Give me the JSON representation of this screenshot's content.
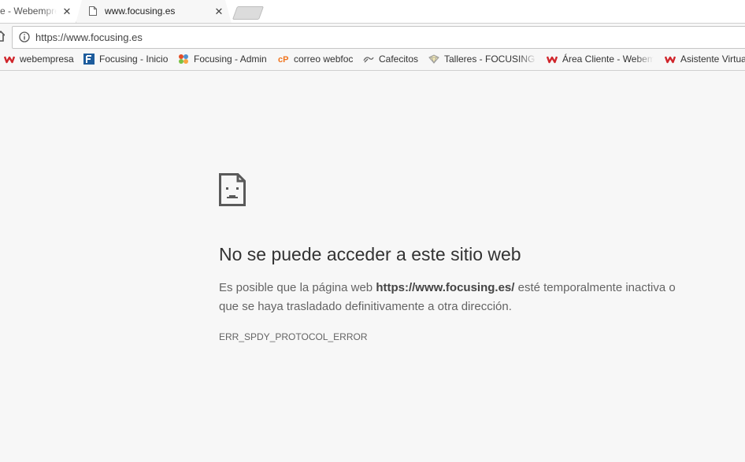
{
  "tabs": [
    {
      "title": "e - Webempresa",
      "close": "✕"
    },
    {
      "title": "www.focusing.es",
      "close": "✕"
    }
  ],
  "omnibox": {
    "url": "https://www.focusing.es"
  },
  "bookmarks": [
    {
      "label": "webempresa",
      "icon": "webempresa-icon"
    },
    {
      "label": "Focusing - Inicio",
      "icon": "focusing-icon"
    },
    {
      "label": "Focusing - Admin",
      "icon": "joomla-icon"
    },
    {
      "label": "correo webfoc",
      "icon": "cpanel-icon"
    },
    {
      "label": "Cafecitos",
      "icon": "cafecitos-icon"
    },
    {
      "label": "Talleres - FOCUSING E",
      "icon": "talleres-icon"
    },
    {
      "label": "Área Cliente - Webem",
      "icon": "webempresa-icon"
    },
    {
      "label": "Asistente Virtual",
      "icon": "webempresa-icon"
    }
  ],
  "error": {
    "title": "No se puede acceder a este sitio web",
    "desc_prefix": "Es posible que la página web ",
    "desc_url": "https://www.focusing.es/",
    "desc_suffix": " esté temporalmente inactiva o que se haya trasladado definitivamente a otra dirección.",
    "code": "ERR_SPDY_PROTOCOL_ERROR"
  },
  "colors": {
    "webempresa_red": "#d0252b",
    "page_bg": "#f7f7f7",
    "focusing_blue": "#1d5c9c",
    "cpanel_orange": "#f0741e"
  }
}
